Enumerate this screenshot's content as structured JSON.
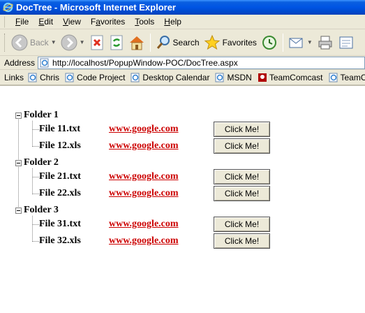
{
  "window": {
    "title": "DocTree - Microsoft Internet Explorer"
  },
  "menu": [
    {
      "u": "F",
      "rest": "ile"
    },
    {
      "u": "E",
      "rest": "dit"
    },
    {
      "u": "V",
      "rest": "iew"
    },
    {
      "pre": "F",
      "u": "a",
      "rest": "vorites"
    },
    {
      "u": "T",
      "rest": "ools"
    },
    {
      "u": "H",
      "rest": "elp"
    }
  ],
  "toolbar": {
    "back_label": "Back",
    "search_label": "Search",
    "favorites_label": "Favorites"
  },
  "address": {
    "label": "Address",
    "url": "http://localhost/PopupWindow-POC/DocTree.aspx"
  },
  "links": {
    "label": "Links",
    "items": [
      "Chris",
      "Code Project",
      "Desktop Calendar",
      "MSDN",
      "TeamComcast",
      "TeamCom"
    ]
  },
  "tree": {
    "folders": [
      {
        "name": "Folder 1",
        "files": [
          {
            "name": "File 11.txt",
            "link": "www.google.com",
            "button": "Click Me!"
          },
          {
            "name": "File 12.xls",
            "link": "www.google.com",
            "button": "Click Me!"
          }
        ]
      },
      {
        "name": "Folder 2",
        "files": [
          {
            "name": "File 21.txt",
            "link": "www.google.com",
            "button": "Click Me!"
          },
          {
            "name": "File 22.xls",
            "link": "www.google.com",
            "button": "Click Me!"
          }
        ]
      },
      {
        "name": "Folder 3",
        "files": [
          {
            "name": "File 31.txt",
            "link": "www.google.com",
            "button": "Click Me!"
          },
          {
            "name": "File 32.xls",
            "link": "www.google.com",
            "button": "Click Me!"
          }
        ]
      }
    ]
  },
  "colors": {
    "titlebar": "#0054e3",
    "chrome": "#ece9d8",
    "link": "#cc0000"
  }
}
